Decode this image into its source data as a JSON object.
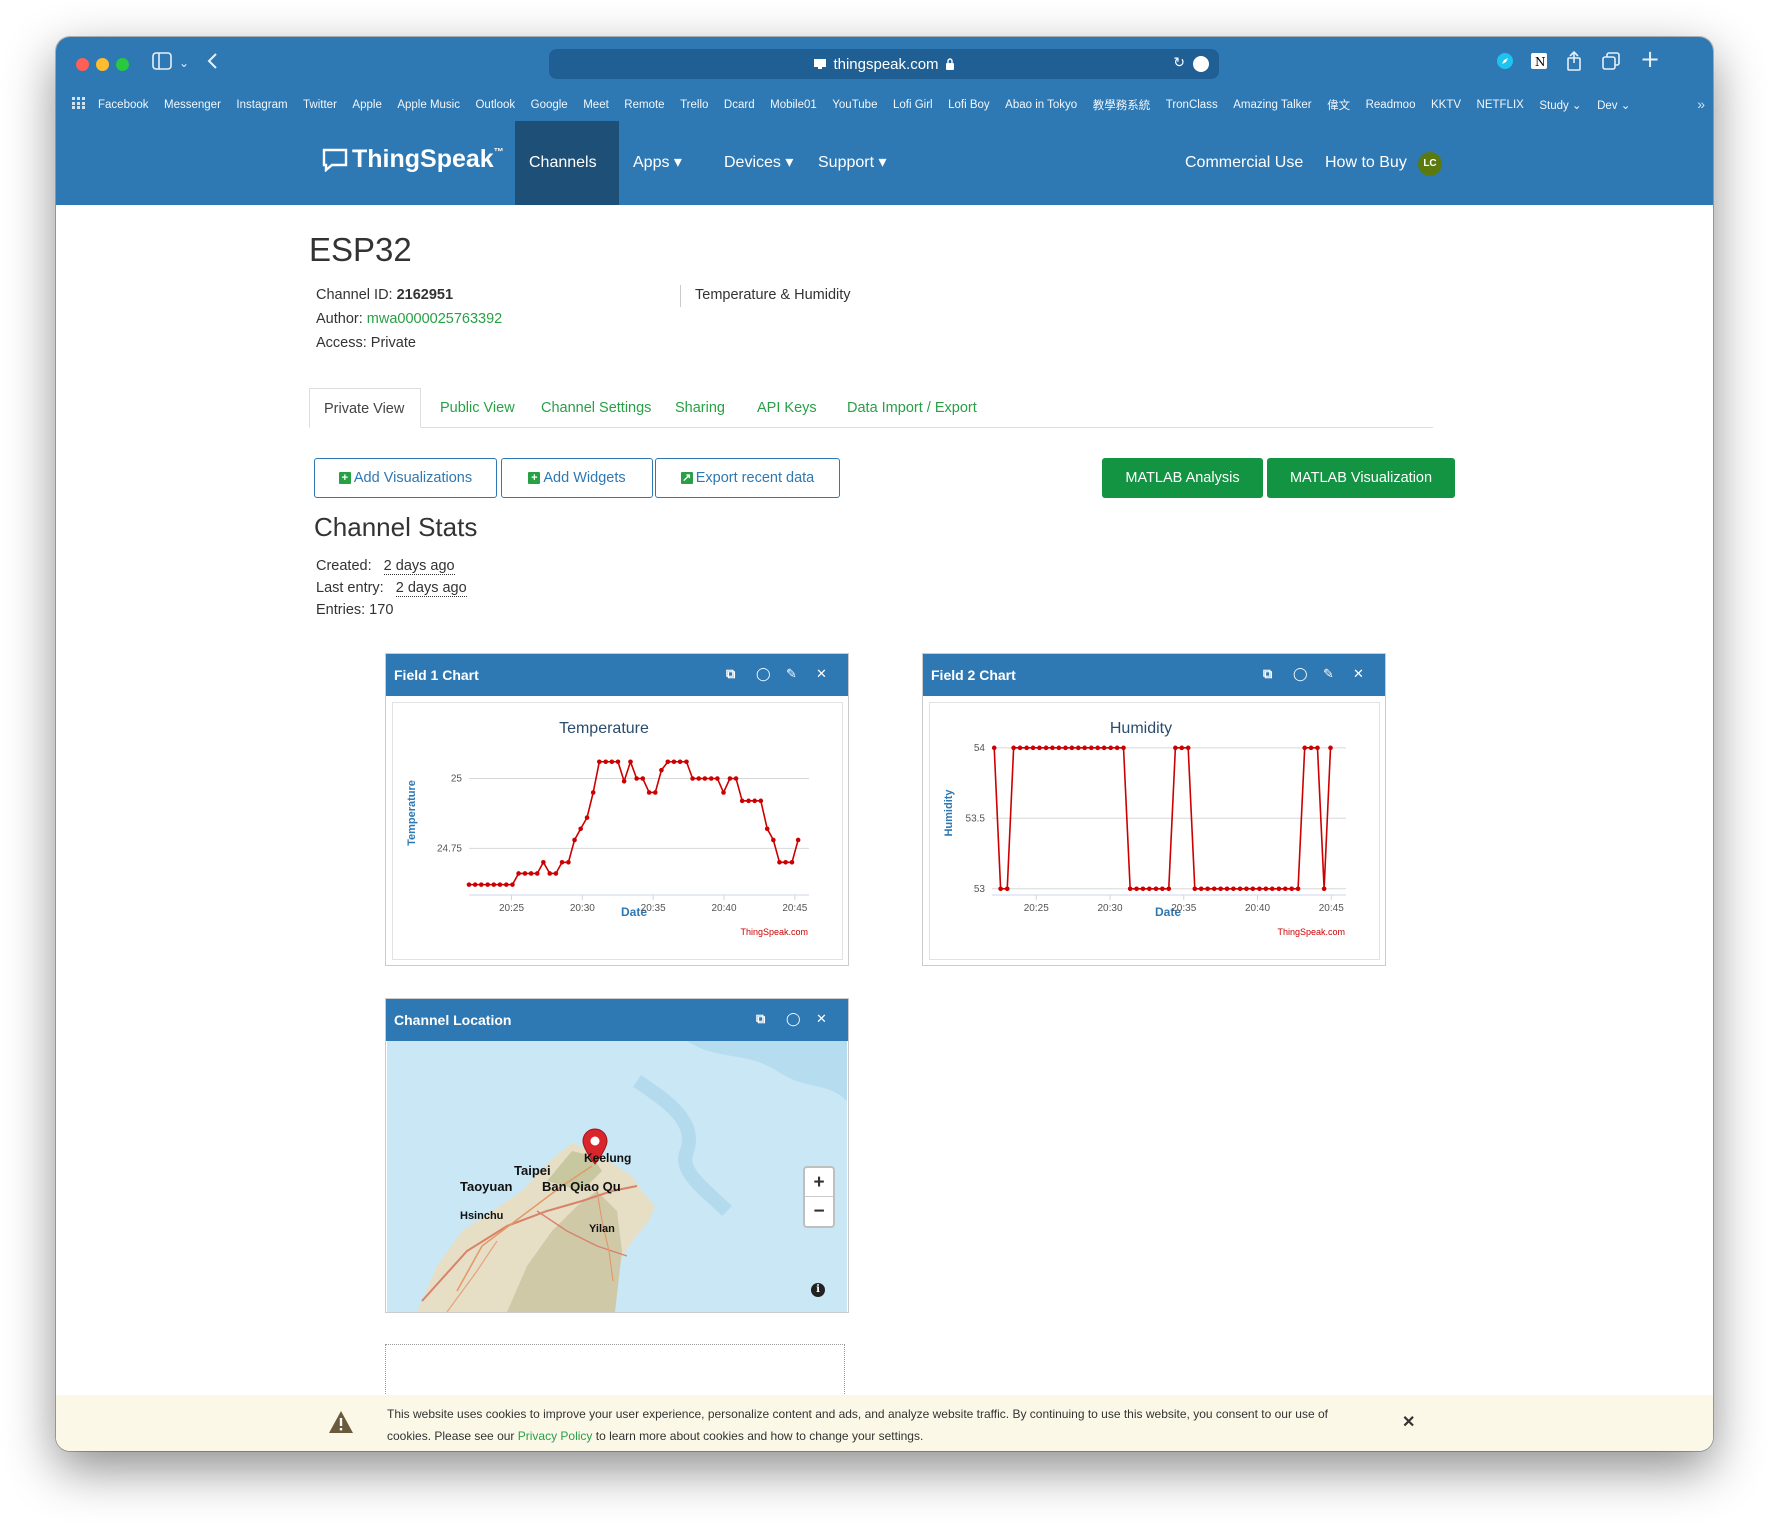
{
  "browser": {
    "url": "thingspeak.com",
    "bookmarks": [
      "Facebook",
      "Messenger",
      "Instagram",
      "Twitter",
      "Apple",
      "Apple Music",
      "Outlook",
      "Google",
      "Meet",
      "Remote",
      "Trello",
      "Dcard",
      "Mobile01",
      "YouTube",
      "Lofi Girl",
      "Lofi Boy",
      "Abao in Tokyo",
      "教學務系統",
      "TronClass",
      "Amazing Talker",
      "偉文",
      "Readmoo",
      "KKTV",
      "NETFLIX",
      "Study ⌄",
      "Dev ⌄"
    ]
  },
  "nav": {
    "logo": "ThingSpeak",
    "trademark": "™",
    "items": [
      "Channels ▾",
      "Apps ▾",
      "Devices ▾",
      "Support ▾"
    ],
    "right_items": [
      "Commercial Use",
      "How to Buy"
    ],
    "avatar": "LC"
  },
  "channel": {
    "name": "ESP32",
    "id_label": "Channel ID:",
    "id_value": "2162951",
    "author_label": "Author:",
    "author_value": "mwa0000025763392",
    "access": "Access: Private",
    "description": "Temperature & Humidity"
  },
  "tabs": [
    "Private View",
    "Public View",
    "Channel Settings",
    "Sharing",
    "API Keys",
    "Data Import / Export"
  ],
  "actions": {
    "add_visualizations": "Add Visualizations",
    "add_widgets": "Add Widgets",
    "export": "Export recent data",
    "matlab_analysis": "MATLAB Analysis",
    "matlab_visualization": "MATLAB Visualization"
  },
  "stats": {
    "title": "Channel Stats",
    "created_label": "Created:",
    "created_value": "2 days ago",
    "last_label": "Last entry:",
    "last_value": "2 days ago",
    "entries": "Entries: 170"
  },
  "panels": {
    "field1": "Field 1 Chart",
    "field2": "Field 2 Chart",
    "location": "Channel Location"
  },
  "chart_data": [
    {
      "type": "line",
      "title": "Temperature",
      "xlabel": "Date",
      "ylabel": "Temperature",
      "credit": "ThingSpeak.com",
      "x_ticks": [
        "20:25",
        "20:30",
        "20:35",
        "20:40",
        "20:45"
      ],
      "y_ticks": [
        24.75,
        25
      ],
      "ylim": [
        24.59,
        25.12
      ],
      "xlim": [
        "20:22",
        "20:46"
      ],
      "color": "#cc0000",
      "x": [
        "20:22:00",
        "20:22:26",
        "20:22:52",
        "20:23:19",
        "20:23:45",
        "20:24:11",
        "20:24:38",
        "20:25:04",
        "20:25:30",
        "20:25:57",
        "20:26:23",
        "20:26:49",
        "20:27:15",
        "20:27:42",
        "20:28:08",
        "20:28:34",
        "20:29:01",
        "20:29:27",
        "20:29:53",
        "20:30:20",
        "20:30:46",
        "20:31:12",
        "20:31:39",
        "20:32:05",
        "20:32:31",
        "20:32:57",
        "20:33:24",
        "20:33:50",
        "20:34:16",
        "20:34:43",
        "20:35:09",
        "20:35:35",
        "20:36:02",
        "20:36:28",
        "20:36:54",
        "20:37:21",
        "20:37:47",
        "20:38:13",
        "20:38:39",
        "20:39:06",
        "20:39:32",
        "20:39:58",
        "20:40:25",
        "20:40:51",
        "20:41:17",
        "20:41:44",
        "20:42:10",
        "20:42:36",
        "20:43:03",
        "20:43:29",
        "20:43:55",
        "20:44:21",
        "20:44:48",
        "20:45:14"
      ],
      "values": [
        24.62,
        24.62,
        24.62,
        24.62,
        24.62,
        24.62,
        24.62,
        24.62,
        24.66,
        24.66,
        24.66,
        24.66,
        24.7,
        24.66,
        24.66,
        24.7,
        24.7,
        24.78,
        24.82,
        24.86,
        24.95,
        25.06,
        25.06,
        25.06,
        25.06,
        24.99,
        25.06,
        25.0,
        25.0,
        24.95,
        24.95,
        25.03,
        25.06,
        25.06,
        25.06,
        25.06,
        25.0,
        25.0,
        25.0,
        25.0,
        25.0,
        24.95,
        25.0,
        25.0,
        24.92,
        24.92,
        24.92,
        24.92,
        24.82,
        24.78,
        24.7,
        24.7,
        24.7,
        24.78,
        24.78
      ]
    },
    {
      "type": "line",
      "title": "Humidity",
      "xlabel": "Date",
      "ylabel": "Humidity",
      "credit": "ThingSpeak.com",
      "x_ticks": [
        "20:25",
        "20:30",
        "20:35",
        "20:40",
        "20:45"
      ],
      "y_ticks": [
        53,
        53.5,
        54
      ],
      "ylim": [
        52.97,
        54.02
      ],
      "xlim": [
        "20:22",
        "20:46"
      ],
      "color": "#cc0000",
      "x": [
        "20:22:09",
        "20:22:35",
        "20:23:02",
        "20:23:28",
        "20:23:54",
        "20:24:21",
        "20:24:47",
        "20:25:13",
        "20:25:40",
        "20:26:06",
        "20:26:32",
        "20:26:59",
        "20:27:25",
        "20:27:51",
        "20:28:17",
        "20:28:44",
        "20:29:10",
        "20:29:36",
        "20:30:03",
        "20:30:29",
        "20:30:55",
        "20:31:22",
        "20:31:48",
        "20:32:14",
        "20:32:40",
        "20:33:07",
        "20:33:33",
        "20:33:59",
        "20:34:26",
        "20:34:52",
        "20:35:18",
        "20:35:45",
        "20:36:11",
        "20:36:37",
        "20:37:04",
        "20:37:30",
        "20:37:56",
        "20:38:22",
        "20:38:49",
        "20:39:15",
        "20:39:41",
        "20:40:08",
        "20:40:34",
        "20:41:00",
        "20:41:27",
        "20:41:53",
        "20:42:19",
        "20:42:45",
        "20:43:12",
        "20:43:38",
        "20:44:04",
        "20:44:31",
        "20:44:57"
      ],
      "values": [
        54,
        53,
        53,
        54,
        54,
        54,
        54,
        54,
        54,
        54,
        54,
        54,
        54,
        54,
        54,
        54,
        54,
        54,
        54,
        54,
        54,
        53,
        53,
        53,
        53,
        53,
        53,
        53,
        54,
        54,
        54,
        53,
        53,
        53,
        53,
        53,
        53,
        53,
        53,
        53,
        53,
        53,
        53,
        53,
        53,
        53,
        53,
        53,
        54,
        54,
        54,
        53,
        54,
        54
      ]
    }
  ],
  "map": {
    "cities": [
      "Keelung",
      "Taipei",
      "Taoyuan",
      "Ban Qiao Qu",
      "Hsinchu",
      "Yilan"
    ],
    "zoom_in": "+",
    "zoom_out": "−"
  },
  "cookie": {
    "text_before": "This website uses cookies to improve your user experience, personalize content and ads, and analyze website traffic. By continuing to use this website, you consent to our use of cookies. Please see our ",
    "link": "Privacy Policy",
    "text_after": " to learn more about cookies and how to change your settings."
  }
}
